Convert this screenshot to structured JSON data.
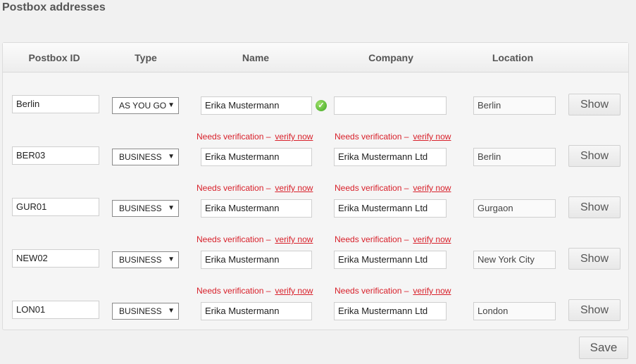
{
  "page": {
    "title": "Postbox addresses"
  },
  "table": {
    "columns": [
      "Postbox ID",
      "Type",
      "Name",
      "Company",
      "Location"
    ],
    "rows": [
      {
        "postbox_id": "Berlin",
        "type": "AS YOU GO",
        "name": "Erika Mustermann",
        "name_verified": true,
        "company": "",
        "location": "Berlin",
        "action": "Show"
      },
      {
        "postbox_id": "BER03",
        "type": "BUSINESS",
        "name": "Erika Mustermann",
        "company": "Erika Mustermann Ltd",
        "location": "Berlin",
        "action": "Show",
        "name_notice": "Needs verification –",
        "name_link": "verify now",
        "company_notice": "Needs verification –",
        "company_link": "verify now"
      },
      {
        "postbox_id": "GUR01",
        "type": "BUSINESS",
        "name": "Erika Mustermann",
        "company": "Erika Mustermann Ltd",
        "location": "Gurgaon",
        "action": "Show",
        "name_notice": "Needs verification –",
        "name_link": "verify now",
        "company_notice": "Needs verification –",
        "company_link": "verify now"
      },
      {
        "postbox_id": "NEW02",
        "type": "BUSINESS",
        "name": "Erika Mustermann",
        "company": "Erika Mustermann Ltd",
        "location": "New York City",
        "action": "Show",
        "name_notice": "Needs verification –",
        "name_link": "verify now",
        "company_notice": "Needs verification –",
        "company_link": "verify now"
      },
      {
        "postbox_id": "LON01",
        "type": "BUSINESS",
        "name": "Erika Mustermann",
        "company": "Erika Mustermann Ltd",
        "location": "London",
        "action": "Show",
        "name_notice": "Needs verification –",
        "name_link": "verify now",
        "company_notice": "Needs verification –",
        "company_link": "verify now"
      }
    ]
  },
  "footer": {
    "save_label": "Save"
  },
  "colors": {
    "warning": "#d8202a",
    "verified": "#3fa822"
  }
}
